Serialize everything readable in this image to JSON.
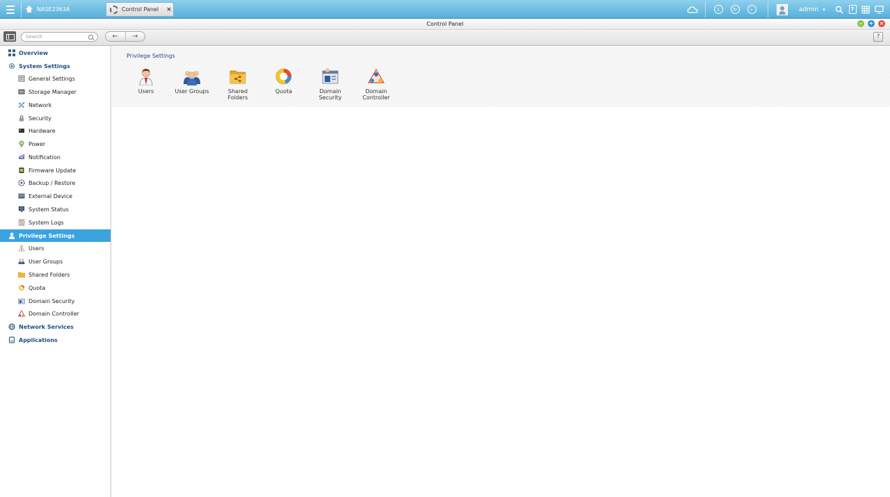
{
  "taskbar": {
    "home_label": "NASE2363A",
    "app_tab_label": "Control Panel",
    "app_tab_close": "×",
    "user_label": "admin",
    "icons": [
      "cloud-icon",
      "download-icon",
      "refresh-icon",
      "info-icon",
      "user-icon",
      "search-icon",
      "help-icon",
      "grid-icon",
      "monitor-icon"
    ]
  },
  "window": {
    "title": "Control Panel",
    "minimize": "–",
    "maximize": "+",
    "close": "×"
  },
  "toolbar": {
    "search_placeholder": "Search",
    "back": "←",
    "forward": "→",
    "help": "?"
  },
  "sidebar": {
    "items": [
      {
        "label": "Overview",
        "level": "top",
        "icon": "overview-icon"
      },
      {
        "label": "System Settings",
        "level": "top",
        "icon": "gear-icon"
      },
      {
        "label": "General Settings",
        "level": "sub",
        "icon": "general-settings-icon"
      },
      {
        "label": "Storage Manager",
        "level": "sub",
        "icon": "storage-icon"
      },
      {
        "label": "Network",
        "level": "sub",
        "icon": "network-icon"
      },
      {
        "label": "Security",
        "level": "sub",
        "icon": "lock-icon"
      },
      {
        "label": "Hardware",
        "level": "sub",
        "icon": "hardware-icon"
      },
      {
        "label": "Power",
        "level": "sub",
        "icon": "power-icon"
      },
      {
        "label": "Notification",
        "level": "sub",
        "icon": "notification-icon"
      },
      {
        "label": "Firmware Update",
        "level": "sub",
        "icon": "firmware-icon"
      },
      {
        "label": "Backup / Restore",
        "level": "sub",
        "icon": "backup-icon"
      },
      {
        "label": "External Device",
        "level": "sub",
        "icon": "external-device-icon"
      },
      {
        "label": "System Status",
        "level": "sub",
        "icon": "monitor-icon"
      },
      {
        "label": "System Logs",
        "level": "sub",
        "icon": "log-icon"
      },
      {
        "label": "Privilege Settings",
        "level": "top",
        "icon": "user-icon",
        "active": true
      },
      {
        "label": "Users",
        "level": "sub",
        "icon": "user-icon"
      },
      {
        "label": "User Groups",
        "level": "sub",
        "icon": "user-groups-icon"
      },
      {
        "label": "Shared Folders",
        "level": "sub",
        "icon": "folder-icon"
      },
      {
        "label": "Quota",
        "level": "sub",
        "icon": "quota-icon"
      },
      {
        "label": "Domain Security",
        "level": "sub",
        "icon": "domain-security-icon"
      },
      {
        "label": "Domain Controller",
        "level": "sub",
        "icon": "domain-controller-icon"
      },
      {
        "label": "Network Services",
        "level": "top",
        "icon": "globe-icon"
      },
      {
        "label": "Applications",
        "level": "top",
        "icon": "applications-icon"
      }
    ]
  },
  "main": {
    "section_title": "Privilege Settings",
    "tiles": [
      {
        "label": "Users",
        "icon": "user-icon"
      },
      {
        "label": "User Groups",
        "icon": "user-groups-icon"
      },
      {
        "label": "Shared Folders",
        "icon": "folder-icon"
      },
      {
        "label": "Quota",
        "icon": "quota-icon"
      },
      {
        "label": "Domain Security",
        "icon": "domain-security-icon"
      },
      {
        "label": "Domain Controller",
        "icon": "domain-controller-icon"
      }
    ]
  },
  "colors": {
    "accent": "#3aa3e0",
    "heading": "#1f4e88",
    "taskbar": "#55afda",
    "minimize": "#8cc63f",
    "maximize": "#2a8fd4",
    "close": "#e8483c"
  }
}
